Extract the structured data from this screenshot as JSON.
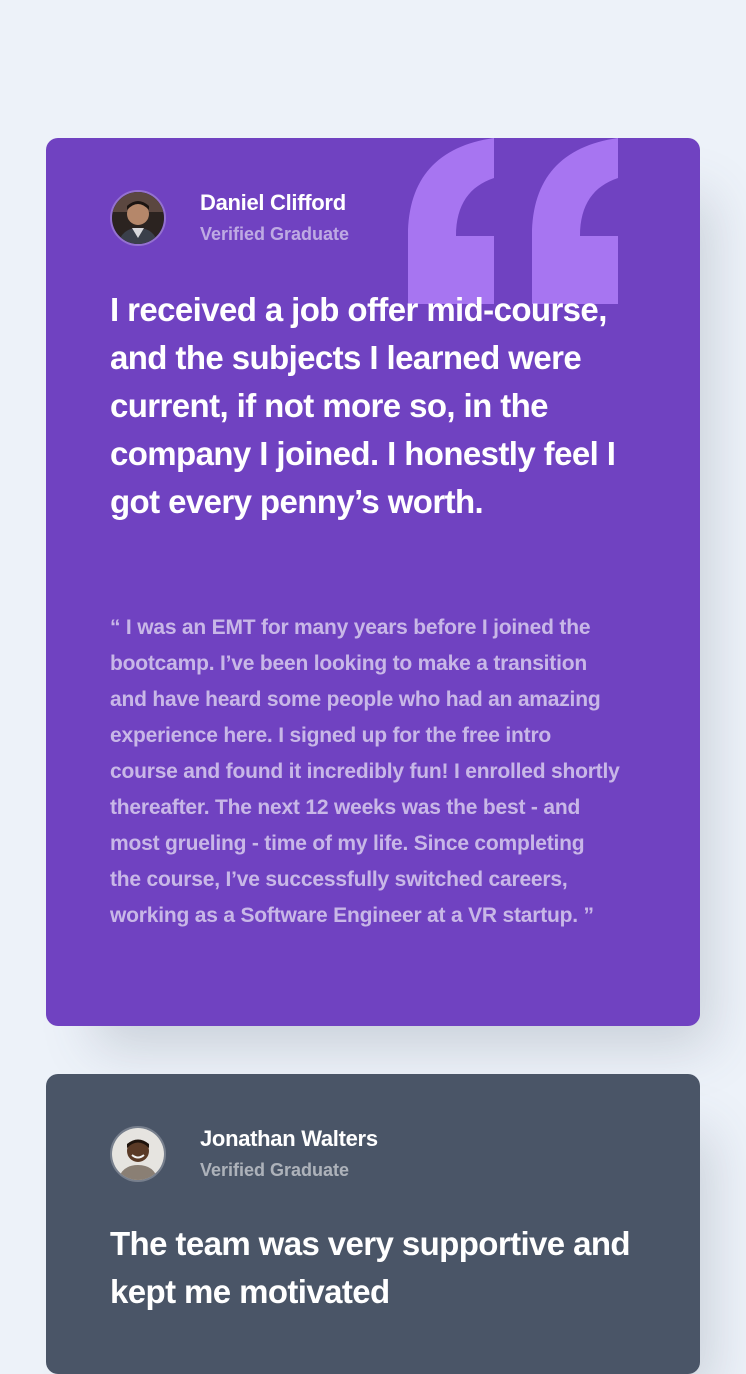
{
  "testimonials": [
    {
      "name": "Daniel Clifford",
      "role": "Verified Graduate",
      "headline": "I received a job offer mid-course, and the subjects I learned were current, if not more so, in the company I joined. I honestly feel I got every penny’s worth.",
      "body": "“ I was an EMT for many years before I joined the bootcamp. I’ve been looking to make a transition and have heard some people who had an amazing experience here. I signed up for the free intro course and found it incredibly fun! I enrolled shortly thereafter. The next 12 weeks was the best - and most grueling - time of my life. Since completing the course, I’ve successfully switched careers, working as a Software Engineer at a VR startup. ”",
      "card_color": "#7042c1",
      "avatar_icon": "person-avatar-icon"
    },
    {
      "name": "Jonathan Walters",
      "role": "Verified Graduate",
      "headline": "The team was very supportive and kept me motivated",
      "card_color": "#4a5567",
      "avatar_icon": "person-avatar-icon"
    }
  ],
  "colors": {
    "background": "#edf2f9",
    "purple_card": "#7042c1",
    "gray_card": "#4a5567",
    "quote_mark": "#a775f1"
  },
  "decor_icon": "quotation-mark-icon"
}
